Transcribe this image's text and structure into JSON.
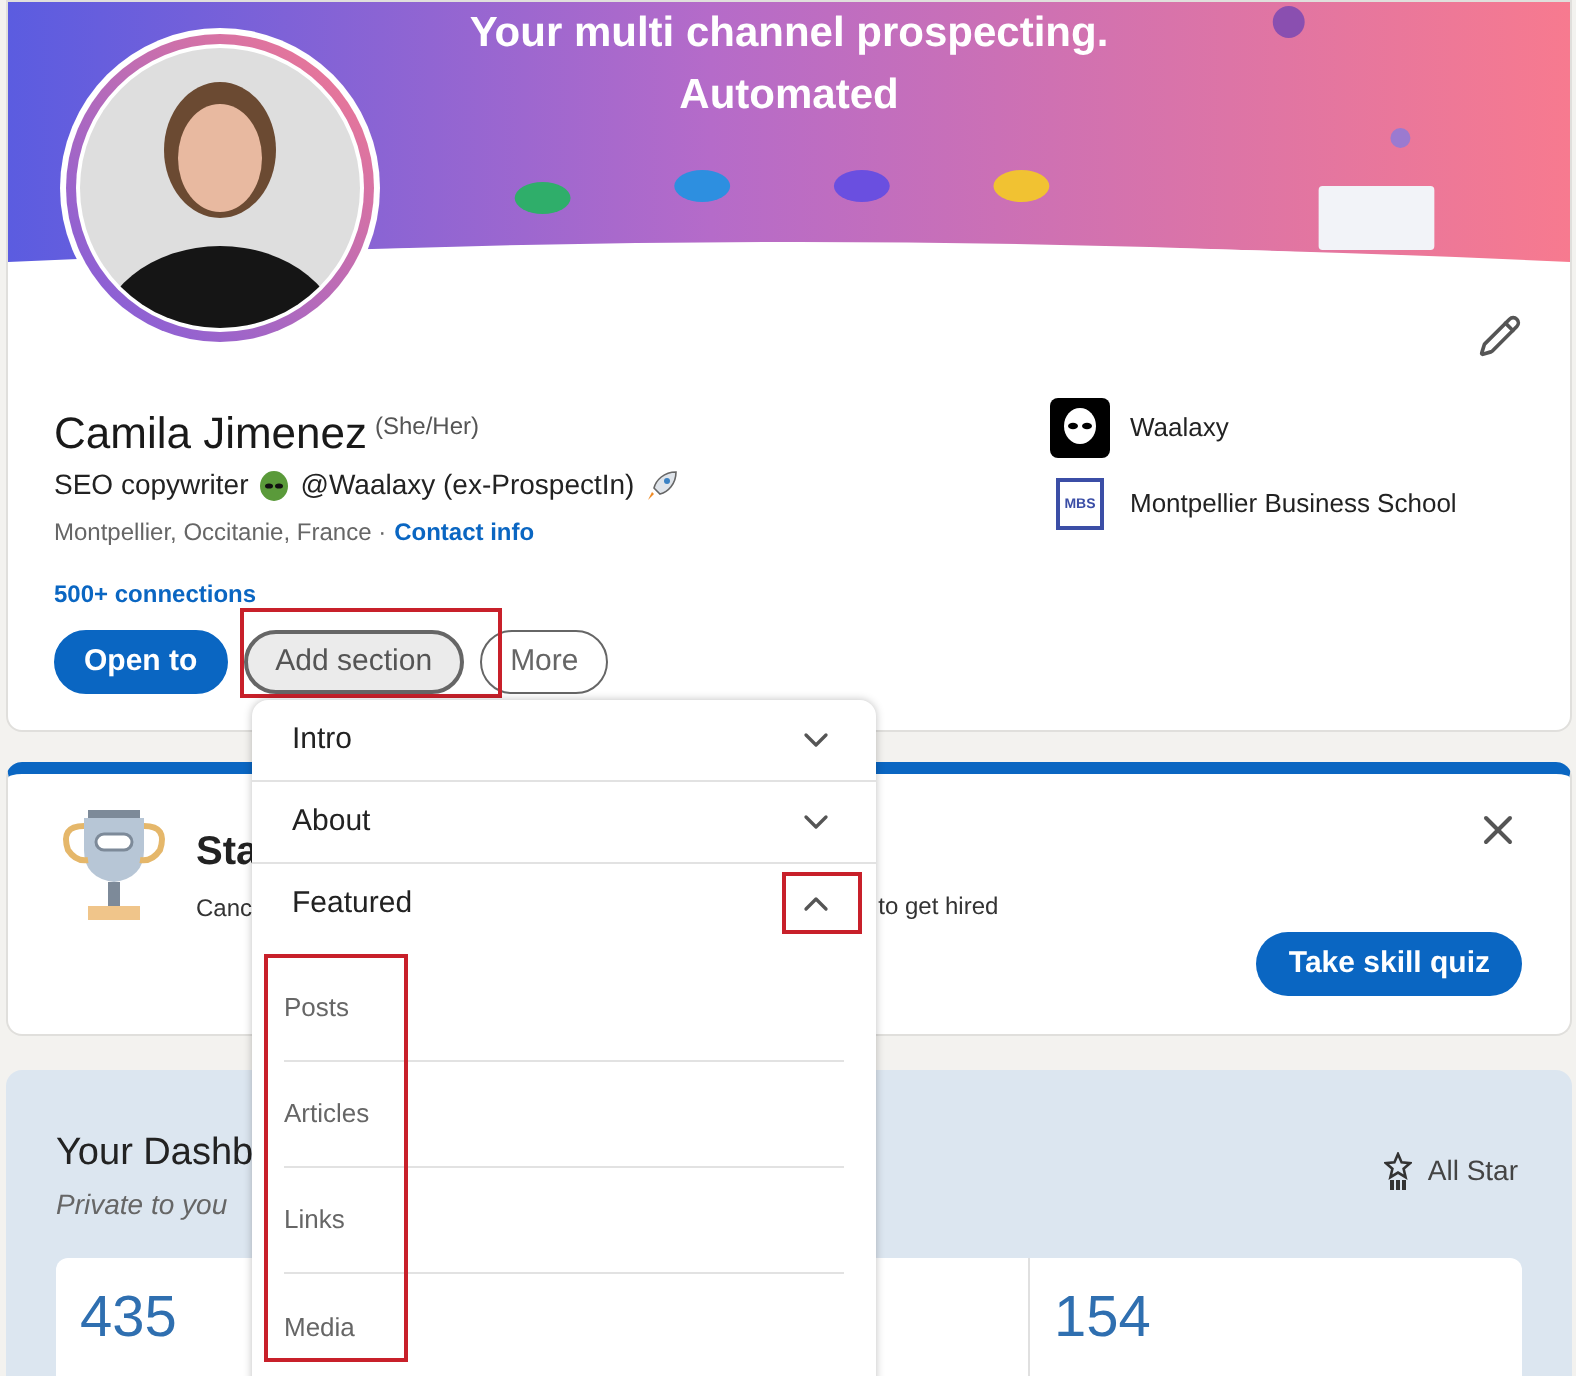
{
  "banner": {
    "headline": "Your multi channel prospecting.",
    "subline": "Automated"
  },
  "profile": {
    "name": "Camila Jimenez",
    "pronouns": "(She/Her)",
    "headline_start": "SEO copywriter",
    "headline_middle": "@Waalaxy (ex-ProspectIn)",
    "location": "Montpellier, Occitanie, France ·",
    "contact_link": "Contact info",
    "connections": "500+ connections"
  },
  "companies": [
    {
      "kind": "alien",
      "name": "Waalaxy"
    },
    {
      "kind": "school",
      "name": "Montpellier Business School",
      "logo_letters": "MBS"
    }
  ],
  "actions": [
    {
      "label": "Open to",
      "kind": "primary"
    },
    {
      "label": "Add section",
      "kind": "pressed"
    },
    {
      "label": "More",
      "kind": "outline"
    }
  ],
  "add_section_menu": [
    {
      "label": "Intro",
      "expanded": false
    },
    {
      "label": "About",
      "expanded": false
    },
    {
      "label": "Featured",
      "expanded": true,
      "children": [
        {
          "label": "Posts"
        },
        {
          "label": "Articles"
        },
        {
          "label": "Links"
        },
        {
          "label": "Media"
        }
      ]
    }
  ],
  "skill_card": {
    "title": "Sta",
    "text_start": "Canc",
    "text_end": "to get hired",
    "button": "Take skill quiz"
  },
  "dashboard": {
    "title": "Your Dashb",
    "subtitle": "Private to you",
    "all_star": "All Star",
    "stats": [
      {
        "value": "435"
      },
      {
        "value": "154"
      }
    ]
  }
}
